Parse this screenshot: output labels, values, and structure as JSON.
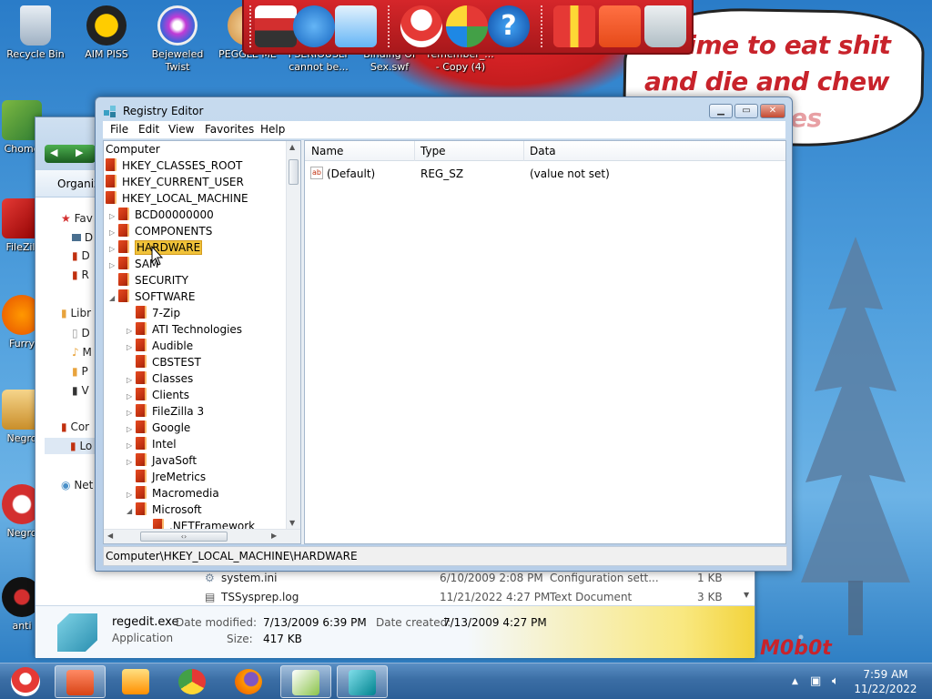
{
  "desktop": {
    "icons_left": [
      {
        "label": "Recycle Bin"
      },
      {
        "label": "AIM PISS"
      },
      {
        "label": "Bejeweled Twist"
      },
      {
        "label": "PEGGLE ME"
      },
      {
        "label": "I SERIOUSLY cannot be..."
      },
      {
        "label": "Binding Of Sex.swf"
      },
      {
        "label": "remember_... - Copy (4)"
      }
    ],
    "icons_side": [
      {
        "label": "Chome"
      },
      {
        "label": "FileZill"
      },
      {
        "label": "Furry"
      },
      {
        "label": "Negro"
      },
      {
        "label": "Negro"
      },
      {
        "label": "anti"
      }
    ],
    "speech_line1": "is time to eat shit",
    "speech_line2": "and die and chew",
    "speech_line3": "es",
    "brand": "M0b0t"
  },
  "explorer": {
    "command_label": "Organiz",
    "sidebar": [
      "Fav",
      "D",
      "D",
      "R",
      "Libr",
      "D",
      "M",
      "P",
      "V",
      "Cor",
      "Lo",
      "Net"
    ],
    "files": [
      {
        "name": "system.ini",
        "date": "6/10/2009 2:08 PM",
        "type": "Configuration sett...",
        "size": "1 KB"
      },
      {
        "name": "TSSysprep.log",
        "date": "11/21/2022 4:27 PM",
        "type": "Text Document",
        "size": "3 KB"
      }
    ],
    "details": {
      "filename": "regedit.exe",
      "filetype": "Application",
      "modified_label": "Date modified:",
      "modified": "7/13/2009 6:39 PM",
      "created_label": "Date created:",
      "created": "7/13/2009 4:27 PM",
      "size_label": "Size:",
      "size": "417 KB"
    }
  },
  "regedit": {
    "title": "Registry Editor",
    "menu": [
      "File",
      "Edit",
      "View",
      "Favorites",
      "Help"
    ],
    "tree": [
      {
        "label": "Computer",
        "level": 0,
        "exp": "",
        "folder": false
      },
      {
        "label": "HKEY_CLASSES_ROOT",
        "level": 0,
        "exp": "",
        "folder": true
      },
      {
        "label": "HKEY_CURRENT_USER",
        "level": 0,
        "exp": "",
        "folder": true
      },
      {
        "label": "HKEY_LOCAL_MACHINE",
        "level": 0,
        "exp": "",
        "folder": true
      },
      {
        "label": "BCD00000000",
        "level": 1,
        "exp": "▷",
        "folder": true
      },
      {
        "label": "COMPONENTS",
        "level": 1,
        "exp": "▷",
        "folder": true
      },
      {
        "label": "HARDWARE",
        "level": 1,
        "exp": "▷",
        "folder": true,
        "selected": true
      },
      {
        "label": "SAM",
        "level": 1,
        "exp": "▷",
        "folder": true
      },
      {
        "label": "SECURITY",
        "level": 1,
        "exp": "",
        "folder": true
      },
      {
        "label": "SOFTWARE",
        "level": 1,
        "exp": "◢",
        "folder": true
      },
      {
        "label": "7-Zip",
        "level": 2,
        "exp": "",
        "folder": true
      },
      {
        "label": "ATI Technologies",
        "level": 2,
        "exp": "▷",
        "folder": true
      },
      {
        "label": "Audible",
        "level": 2,
        "exp": "▷",
        "folder": true
      },
      {
        "label": "CBSTEST",
        "level": 2,
        "exp": "",
        "folder": true
      },
      {
        "label": "Classes",
        "level": 2,
        "exp": "▷",
        "folder": true
      },
      {
        "label": "Clients",
        "level": 2,
        "exp": "▷",
        "folder": true
      },
      {
        "label": "FileZilla 3",
        "level": 2,
        "exp": "▷",
        "folder": true
      },
      {
        "label": "Google",
        "level": 2,
        "exp": "▷",
        "folder": true
      },
      {
        "label": "Intel",
        "level": 2,
        "exp": "▷",
        "folder": true
      },
      {
        "label": "JavaSoft",
        "level": 2,
        "exp": "▷",
        "folder": true
      },
      {
        "label": "JreMetrics",
        "level": 2,
        "exp": "",
        "folder": true
      },
      {
        "label": "Macromedia",
        "level": 2,
        "exp": "▷",
        "folder": true
      },
      {
        "label": "Microsoft",
        "level": 2,
        "exp": "◢",
        "folder": true
      },
      {
        "label": ".NETFramework",
        "level": 3,
        "exp": "",
        "folder": true
      }
    ],
    "columns": [
      "Name",
      "Type",
      "Data"
    ],
    "values": [
      {
        "name": "(Default)",
        "type": "REG_SZ",
        "data": "(value not set)"
      }
    ],
    "status": "Computer\\HKEY_LOCAL_MACHINE\\HARDWARE"
  },
  "taskbar": {
    "time": "7:59 AM",
    "date": "11/22/2022"
  }
}
